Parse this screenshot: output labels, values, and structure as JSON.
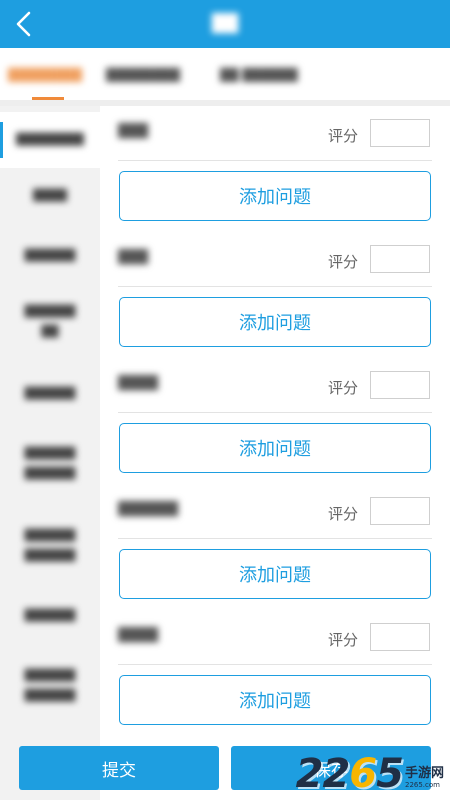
{
  "app_bar": {
    "title": "██",
    "back_icon": "chevron-left-icon"
  },
  "tabs": [
    {
      "label": "████████",
      "active": true
    },
    {
      "label": "████████",
      "active": false
    },
    {
      "label": "██ ██████",
      "active": false
    }
  ],
  "sidebar": {
    "items": [
      {
        "label": "████████",
        "active": true
      },
      {
        "label": "████",
        "active": false
      },
      {
        "label": "██████",
        "active": false
      },
      {
        "label": "██████\n██",
        "active": false
      },
      {
        "label": "██████",
        "active": false
      },
      {
        "label": "██████\n██████",
        "active": false
      },
      {
        "label": "██████\n██████",
        "active": false
      },
      {
        "label": "██████",
        "active": false
      },
      {
        "label": "██████\n██████",
        "active": false
      }
    ]
  },
  "questions": [
    {
      "name": "███",
      "score_label": "评分",
      "score_value": ""
    },
    {
      "name": "███",
      "score_label": "评分",
      "score_value": ""
    },
    {
      "name": "████",
      "score_label": "评分",
      "score_value": ""
    },
    {
      "name": "██████",
      "score_label": "评分",
      "score_value": ""
    },
    {
      "name": "████",
      "score_label": "评分",
      "score_value": ""
    }
  ],
  "add_question_label": "添加问题",
  "footer": {
    "submit_label": "提交",
    "save_label": "保存"
  },
  "watermark": {
    "number_a": "22",
    "number_b": "6",
    "number_c": "5",
    "brand": "手游网",
    "url": "2265.com"
  },
  "colors": {
    "primary": "#1e9ee0",
    "tab_active": "#f08a3a",
    "sidebar_bg": "#f2f2f2"
  }
}
